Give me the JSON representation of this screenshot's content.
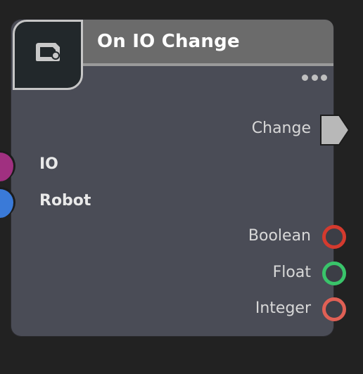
{
  "node": {
    "title": "On IO Change",
    "icon": "event-node-icon",
    "more_icon": "more-options-icon",
    "header_color": "#6b6b6b",
    "body_color": "#4a4c56",
    "outputs": {
      "exec": {
        "label": "Change",
        "icon": "exec-arrow-pin",
        "color": "#b8b8b8"
      },
      "boolean": {
        "label": "Boolean",
        "color": "#d43a2e"
      },
      "float": {
        "label": "Float",
        "color": "#39c46a"
      },
      "integer": {
        "label": "Integer",
        "color": "#e06055"
      }
    },
    "inputs": {
      "io": {
        "label": "IO",
        "color": "#a03080"
      },
      "robot": {
        "label": "Robot",
        "color": "#3a7ad8"
      }
    }
  }
}
